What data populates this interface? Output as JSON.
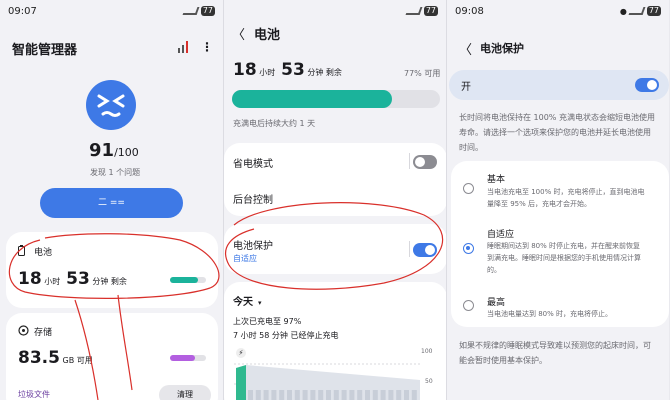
{
  "s1": {
    "time": "09:07",
    "battery": "77"
  },
  "s2": {
    "battery": "77"
  },
  "s3": {
    "time": "09:08",
    "battery": "77"
  },
  "p1": {
    "title": "智能管理器",
    "score": "91",
    "score_total": "/100",
    "issues": "发现 1 个问题",
    "fix_button": "二 ==",
    "battery": {
      "title": "电池",
      "h": "18",
      "h_unit": "小时",
      "m": "53",
      "m_unit": "分钟 剩余",
      "percent": 77
    },
    "storage": {
      "title": "存储",
      "value": "83.5",
      "unit": "GB 可用",
      "percent": 70
    },
    "junk": {
      "label": "垃圾文件",
      "button": "清理"
    }
  },
  "p2": {
    "back": "〈",
    "title": "电池",
    "h": "18",
    "h_unit": "小时",
    "m": "53",
    "m_unit": "分钟 剩余",
    "percent_label": "77% 可用",
    "level": 77,
    "charge_info": "充满电后持续大约 1 天",
    "power_saving": "省电模式",
    "power_saving_on": false,
    "bg_control": "后台控制",
    "protection": "电池保护",
    "protection_sub": "自适应",
    "protection_on": true,
    "today": "今天",
    "last_charge": "上次已充电至 97%",
    "since": "7 小时 58 分钟 已经停止充电",
    "chart_top": "100",
    "chart_mid": "50"
  },
  "p3": {
    "back": "〈",
    "title": "电池保护",
    "on_label": "开",
    "on": true,
    "desc": [
      "长时间将电池保持在 100% 充满电状态会缩短电池使用",
      "寿命。请选择一个选项来保护您的电池并延长电池使用",
      "时间。"
    ],
    "options": [
      {
        "title": "基本",
        "desc": [
          "当电池充电至 100% 时，充电将停止，直到电池电",
          "量降至 95% 后，充电才会开始。"
        ],
        "selected": false
      },
      {
        "title": "自适应",
        "desc": [
          "睡眠期间达到 80% 时停止充电，并在醒来前恢复",
          "到满充电。睡眠时间是根据您的手机使用情况计算",
          "的。"
        ],
        "selected": true
      },
      {
        "title": "最高",
        "desc": [
          "当电池电量达到 80% 时，充电将停止。"
        ],
        "selected": false
      }
    ],
    "footer": [
      "如果不规律的睡眠模式导致难以预测您的起床时间，可",
      "能会暂时使用基本保护。"
    ]
  },
  "colors": {
    "accent": "#3e79e6",
    "battery_bar": "#1bb39b",
    "storage_bar": "#b35fe0",
    "annotation": "#d9302b"
  }
}
